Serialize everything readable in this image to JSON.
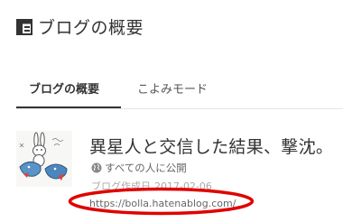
{
  "header": {
    "title": "ブログの概要",
    "icon": "dashboard-icon"
  },
  "tabs": [
    {
      "label": "ブログの概要",
      "active": true
    },
    {
      "label": "こよみモード",
      "active": false
    }
  ],
  "blog": {
    "title": "異星人と交信した結果、撃沈。",
    "privacy": "すべての人に公開",
    "privacy_icon": "globe-icon",
    "created_label": "ブログ作成日",
    "created_date": "2017-02-06",
    "url": "https://bolla.hatenablog.com/"
  },
  "colors": {
    "text": "#333333",
    "muted": "#666666",
    "annotation": "#e00000"
  }
}
